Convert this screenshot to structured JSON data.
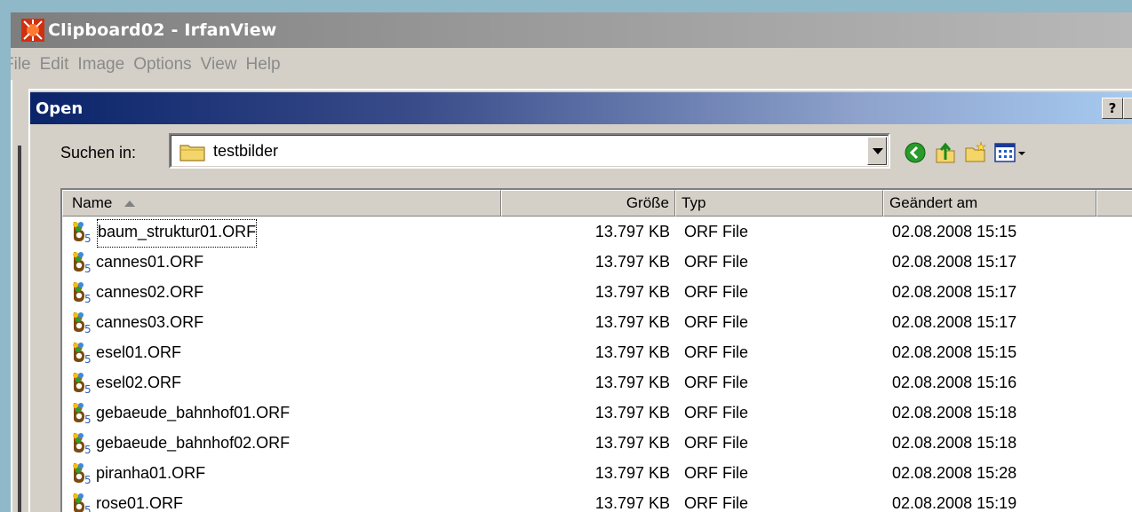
{
  "window": {
    "title": "Clipboard02 - IrfanView"
  },
  "menu": [
    "File",
    "Edit",
    "Image",
    "Options",
    "View",
    "Help"
  ],
  "dialog": {
    "title": "Open",
    "help_label": "?",
    "look_in_label": "Suchen in:",
    "look_in_value": "testbilder",
    "toolbar_icons": [
      "back-icon",
      "up-folder-icon",
      "new-folder-icon",
      "view-menu-icon"
    ]
  },
  "columns": [
    "Name",
    "Größe",
    "Typ",
    "Geändert am"
  ],
  "files": [
    {
      "name": "baum_struktur01.ORF",
      "size": "13.797 KB",
      "type": "ORF File",
      "modified": "02.08.2008 15:15"
    },
    {
      "name": "cannes01.ORF",
      "size": "13.797 KB",
      "type": "ORF File",
      "modified": "02.08.2008 15:17"
    },
    {
      "name": "cannes02.ORF",
      "size": "13.797 KB",
      "type": "ORF File",
      "modified": "02.08.2008 15:17"
    },
    {
      "name": "cannes03.ORF",
      "size": "13.797 KB",
      "type": "ORF File",
      "modified": "02.08.2008 15:17"
    },
    {
      "name": "esel01.ORF",
      "size": "13.797 KB",
      "type": "ORF File",
      "modified": "02.08.2008 15:15"
    },
    {
      "name": "esel02.ORF",
      "size": "13.797 KB",
      "type": "ORF File",
      "modified": "02.08.2008 15:16"
    },
    {
      "name": "gebaeude_bahnhof01.ORF",
      "size": "13.797 KB",
      "type": "ORF File",
      "modified": "02.08.2008 15:18"
    },
    {
      "name": "gebaeude_bahnhof02.ORF",
      "size": "13.797 KB",
      "type": "ORF File",
      "modified": "02.08.2008 15:18"
    },
    {
      "name": "piranha01.ORF",
      "size": "13.797 KB",
      "type": "ORF File",
      "modified": "02.08.2008 15:28"
    },
    {
      "name": "rose01.ORF",
      "size": "13.797 KB",
      "type": "ORF File",
      "modified": "02.08.2008 15:19"
    }
  ]
}
